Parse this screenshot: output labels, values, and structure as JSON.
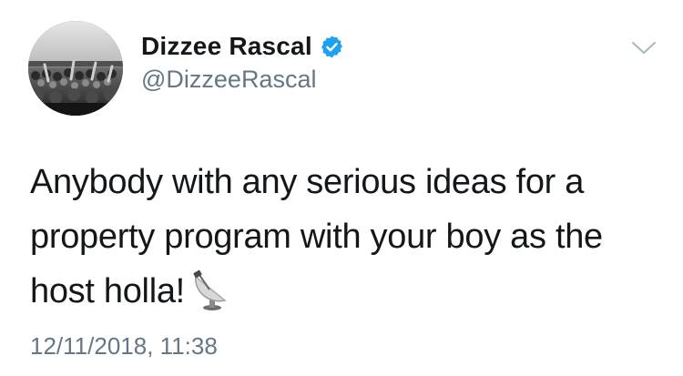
{
  "user": {
    "display_name": "Dizzee Rascal",
    "handle": "@DizzeeRascal",
    "verified": true
  },
  "tweet": {
    "lines": [
      "Anybody with any serious ideas for a",
      "property program with your boy as the",
      "host holla!"
    ],
    "emoji": "satellite-dish-emoji",
    "timestamp": "12/11/2018, 11:38"
  },
  "icons": {
    "verified": "verified-badge-icon",
    "menu": "chevron-down-icon"
  },
  "colors": {
    "text": "#14171a",
    "secondary": "#657786",
    "verified_blue": "#1da1f2",
    "caret": "#aab8c2"
  }
}
